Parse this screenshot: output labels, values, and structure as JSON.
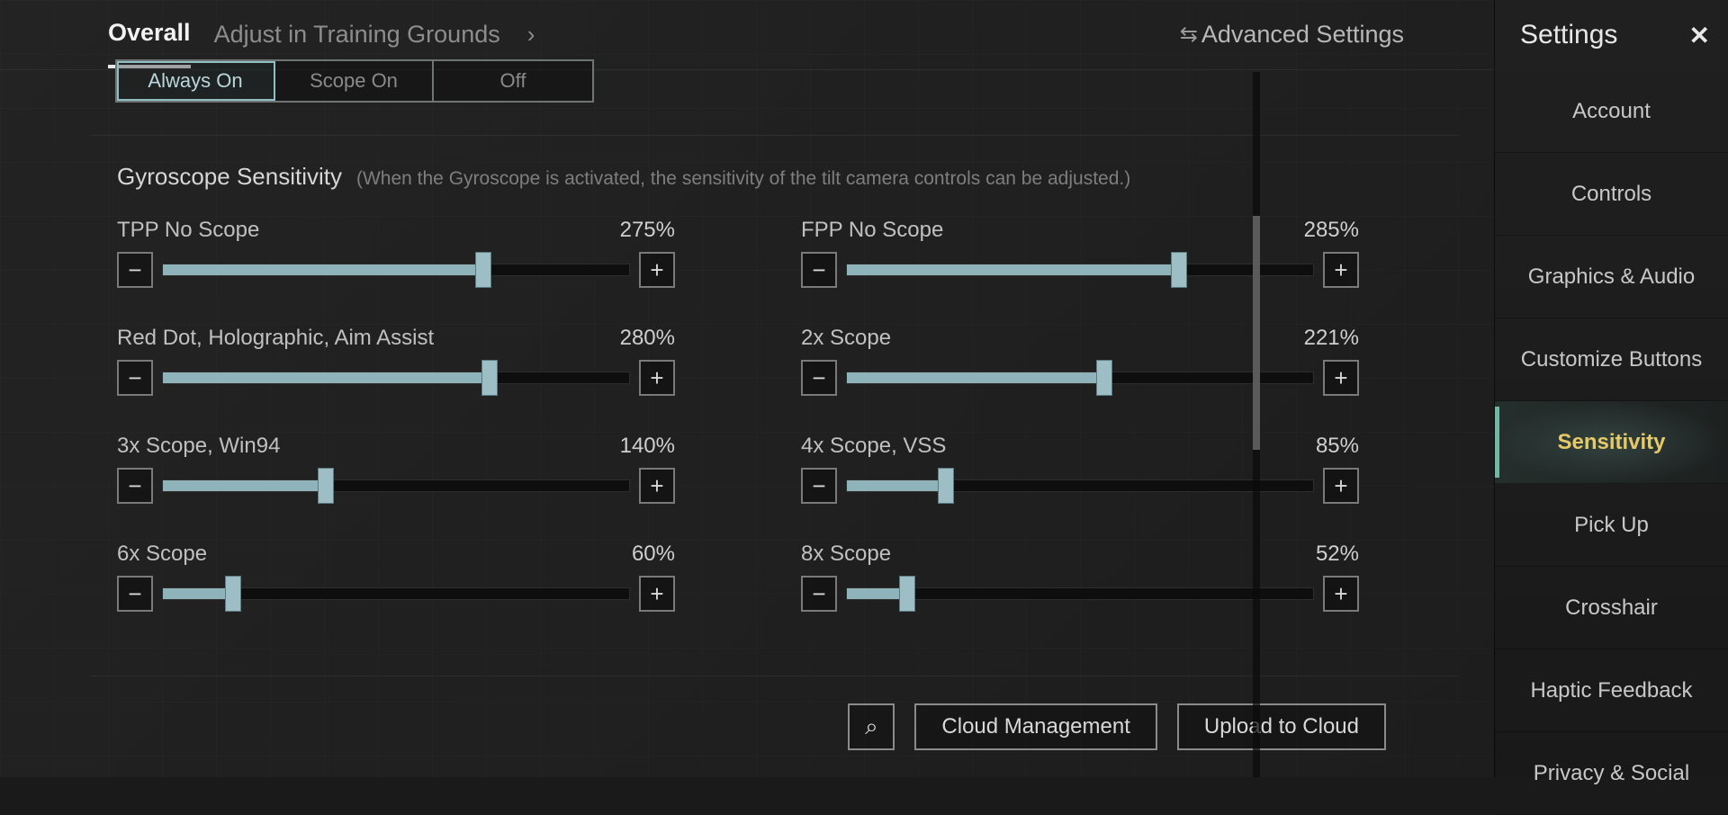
{
  "topbar": {
    "tabs": [
      "Overall",
      "Adjust in Training Grounds"
    ],
    "active_tab": 0,
    "advanced_label": "Advanced Settings"
  },
  "segmented": {
    "options": [
      "Always On",
      "Scope On",
      "Off"
    ],
    "selected": 0
  },
  "section": {
    "title": "Gyroscope Sensitivity",
    "description": "(When the Gyroscope is activated, the sensitivity of the tilt camera controls can be adjusted.)"
  },
  "sliders": [
    {
      "label": "TPP No Scope",
      "value": 275,
      "max": 400
    },
    {
      "label": "FPP No Scope",
      "value": 285,
      "max": 400
    },
    {
      "label": "Red Dot, Holographic, Aim Assist",
      "value": 280,
      "max": 400
    },
    {
      "label": "2x Scope",
      "value": 221,
      "max": 400
    },
    {
      "label": "3x Scope, Win94",
      "value": 140,
      "max": 400
    },
    {
      "label": "4x Scope, VSS",
      "value": 85,
      "max": 400
    },
    {
      "label": "6x Scope",
      "value": 60,
      "max": 400
    },
    {
      "label": "8x Scope",
      "value": 52,
      "max": 400
    }
  ],
  "bottom": {
    "search_icon": "search-icon",
    "cloud_mgmt": "Cloud Management",
    "upload": "Upload to Cloud"
  },
  "right": {
    "title": "Settings",
    "items": [
      "Account",
      "Controls",
      "Graphics & Audio",
      "Customize Buttons",
      "Sensitivity",
      "Pick Up",
      "Crosshair",
      "Haptic Feedback",
      "Privacy & Social"
    ],
    "active_index": 4
  },
  "glyphs": {
    "minus": "−",
    "plus": "+",
    "chevron_right": "›",
    "search": "⌕",
    "close": "✕",
    "swap": "⇆"
  }
}
